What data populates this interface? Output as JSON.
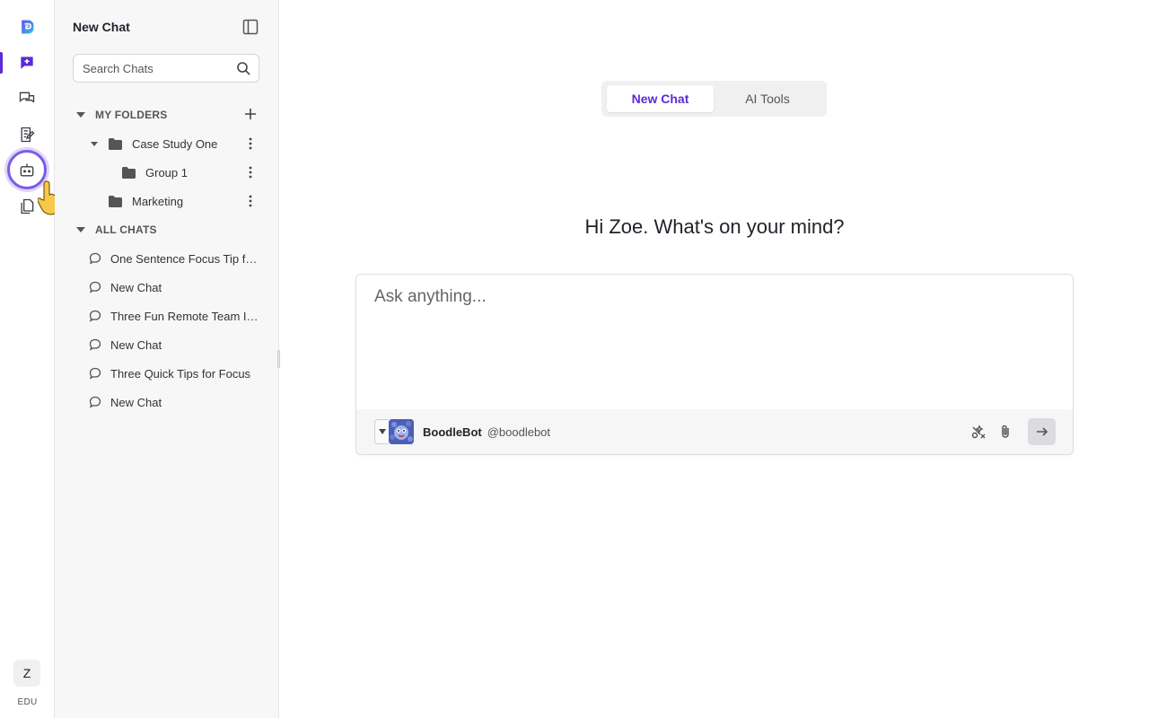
{
  "rail": {
    "avatar_initial": "Z",
    "plan_label": "EDU",
    "items": [
      {
        "name": "logo-icon"
      },
      {
        "name": "new-chat-icon"
      },
      {
        "name": "chats-icon"
      },
      {
        "name": "notes-icon"
      },
      {
        "name": "bot-icon"
      },
      {
        "name": "documents-icon"
      }
    ]
  },
  "sidebar": {
    "title": "New Chat",
    "search_placeholder": "Search Chats",
    "my_folders_label": "MY FOLDERS",
    "all_chats_label": "ALL CHATS",
    "folders": [
      {
        "label": "Case Study One"
      },
      {
        "label": "Group 1"
      },
      {
        "label": "Marketing"
      }
    ],
    "chats": [
      {
        "label": "One Sentence Focus Tip for Work"
      },
      {
        "label": "New Chat"
      },
      {
        "label": "Three Fun Remote Team Ideas"
      },
      {
        "label": "New Chat"
      },
      {
        "label": "Three Quick Tips for Focus"
      },
      {
        "label": "New Chat"
      }
    ]
  },
  "main": {
    "tabs": [
      {
        "label": "New Chat",
        "active": true
      },
      {
        "label": "AI Tools",
        "active": false
      }
    ],
    "greeting": "Hi Zoe. What's on your mind?",
    "composer": {
      "placeholder": "Ask anything...",
      "bot_name": "BoodleBot",
      "bot_handle": "@boodlebot"
    }
  },
  "colors": {
    "accent": "#5b2bd6",
    "ring": "#7b5ce6"
  }
}
